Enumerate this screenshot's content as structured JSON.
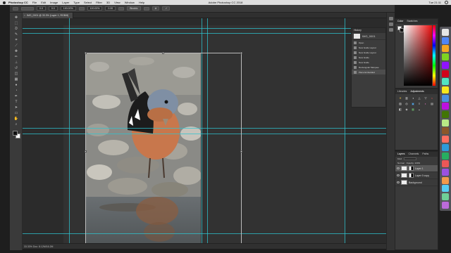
{
  "menubar": {
    "app_name": "Photoshop CC",
    "items": [
      "File",
      "Edit",
      "Image",
      "Layer",
      "Type",
      "Select",
      "Filter",
      "3D",
      "View",
      "Window",
      "Help"
    ],
    "window_title": "Adobe Photoshop CC 2018",
    "clock": "Tue 21:11"
  },
  "optbar": {
    "field1": "0.0",
    "field2": "0.0",
    "field3": "100.00%",
    "field4": "100.00%",
    "field5": "0.00",
    "interpolation": "Bicubic",
    "cancel": "⊘",
    "commit": "✓"
  },
  "document": {
    "tab_label": "IMG_0001 @ 33.3% (Layer 1, RGB/8)",
    "status_text": "33.33%    Doc: 8.12M/16.2M"
  },
  "history": {
    "title": "History",
    "snapshot_label": "IMG_0001",
    "items": [
      "Open",
      "New Guide Layout",
      "New Guide Layout",
      "New Guide",
      "New Guide",
      "Rectangular Marquee",
      "Place Embedded"
    ],
    "active_index": 6
  },
  "color_panel": {
    "tabs": [
      "Color",
      "Swatches"
    ],
    "accent": "#ee1010"
  },
  "adjustments": {
    "tabs": [
      "Libraries",
      "Adjustments"
    ],
    "icons": [
      "☀",
      "▥",
      "◑",
      "△",
      "▽",
      "≈",
      "▨",
      "◎",
      "▣",
      "≡",
      "◐",
      "▤",
      "◧",
      "◈",
      "▦",
      "◒"
    ]
  },
  "layers": {
    "tabs": [
      "Layers",
      "Channels",
      "Paths"
    ],
    "kind_label": "Kind",
    "mode_label": "Normal",
    "opacity_label": "Opacity: 100%",
    "rows": [
      {
        "name": "Layer 1",
        "selected": true,
        "type": "masked"
      },
      {
        "name": "Layer 0 copy",
        "selected": false,
        "type": "masked"
      },
      {
        "name": "Background",
        "selected": false,
        "type": "plain"
      }
    ]
  },
  "dock": {
    "colors": [
      "#e6e6e6",
      "#4f86f7",
      "#f5a623",
      "#7ed321",
      "#9013fe",
      "#d0021b",
      "#50e3c2",
      "#f8e71c",
      "#4a90e2",
      "#bd10e0",
      "#417505",
      "#b8e986",
      "#8b572a",
      "#ff6f61",
      "#2d9cdb",
      "#27ae60",
      "#eb5757",
      "#9b51e0",
      "#f2994a",
      "#56ccf2",
      "#6fcf97",
      "#bb6bd9"
    ]
  }
}
